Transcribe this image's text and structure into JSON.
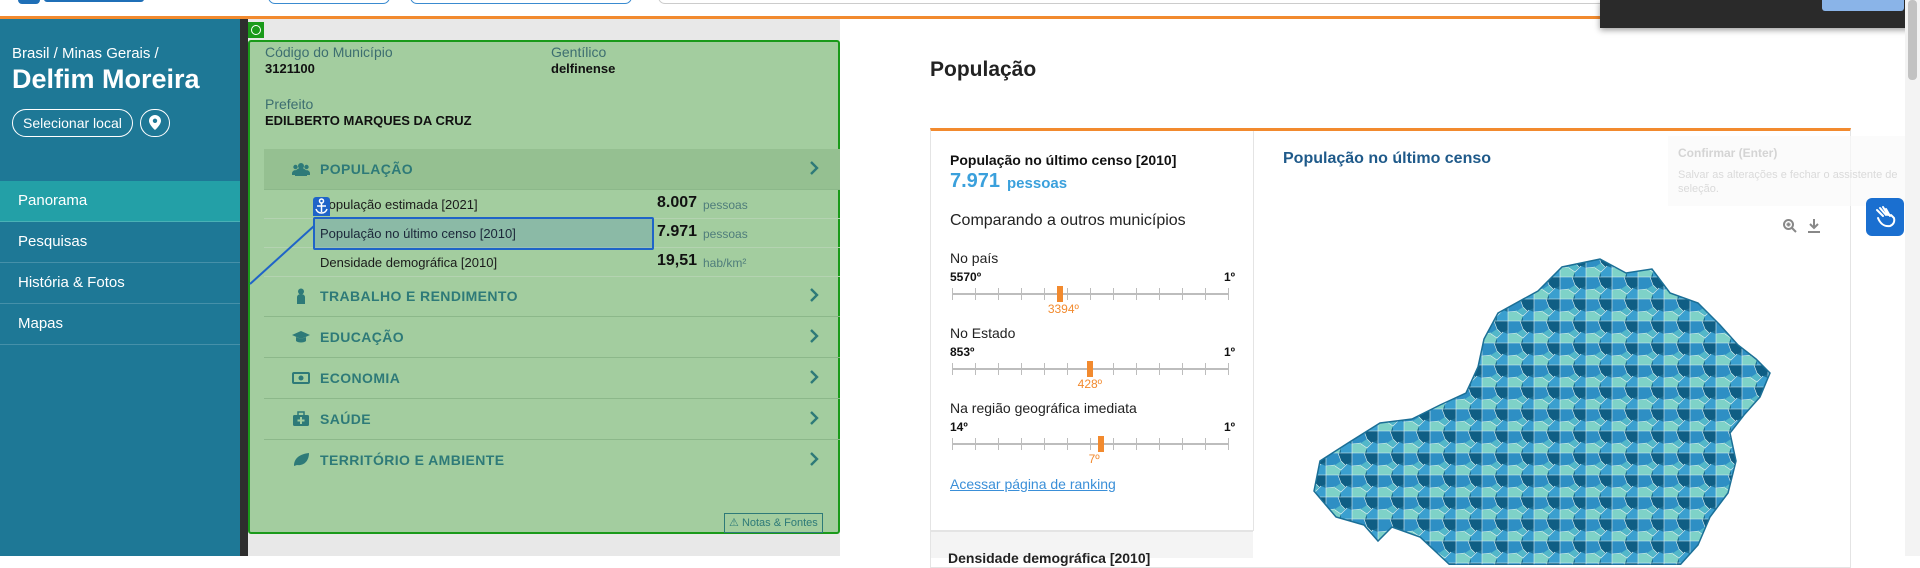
{
  "header": {},
  "breadcrumb": "Brasil / Minas Gerais /",
  "city": "Delfim Moreira",
  "select_place_label": "Selecionar local",
  "nav": [
    {
      "label": "Panorama",
      "active": true
    },
    {
      "label": "Pesquisas"
    },
    {
      "label": "História & Fotos"
    },
    {
      "label": "Mapas"
    }
  ],
  "info": {
    "codigo_label": "Código do Município",
    "codigo_value": "3121100",
    "gentilico_label": "Gentílico",
    "gentilico_value": "delfinense",
    "prefeito_label": "Prefeito",
    "prefeito_value": "EDILBERTO MARQUES DA CRUZ"
  },
  "sections": {
    "populacao": "POPULAÇÃO",
    "trabalho": "TRABALHO E RENDIMENTO",
    "educacao": "EDUCAÇÃO",
    "economia": "ECONOMIA",
    "saude": "SAÚDE",
    "territorio": "TERRITÓRIO E AMBIENTE"
  },
  "population_rows": [
    {
      "label": "População estimada [2021]",
      "value": "8.007",
      "unit": "pessoas"
    },
    {
      "label": "População no último censo [2010]",
      "value": "7.971",
      "unit": "pessoas"
    },
    {
      "label": "Densidade demográfica [2010]",
      "value": "19,51",
      "unit": "hab/km²"
    }
  ],
  "notes_label": "Notas & Fontes",
  "main": {
    "title": "População",
    "stat_title": "População no último censo [2010]",
    "stat_value": "7.971",
    "stat_unit": "pessoas",
    "compare_title": "Comparando a outros municípios",
    "rankings": [
      {
        "label": "No país",
        "low": "5570º",
        "high": "1º",
        "value": "3394º",
        "position": 0.3907
      },
      {
        "label": "No Estado",
        "low": "853º",
        "high": "1º",
        "value": "428º",
        "position": 0.4988
      },
      {
        "label": "Na região geográfica imediata",
        "low": "14º",
        "high": "1º",
        "value": "7º",
        "position": 0.5385
      }
    ],
    "ranking_link": "Acessar página de ranking",
    "next_stat_title": "Densidade demográfica [2010]",
    "map_title": "População no último censo"
  },
  "tooltip": {
    "title": "Confirmar (Enter)",
    "text": "Salvar as alterações e fechar o assistente de seleção."
  },
  "colors": {
    "sidebar": "#1e7896",
    "accent": "#f28a2e",
    "highlight_green": "#a3cd9f",
    "map_dark": "#1b6f96",
    "map_light": "#7ed2c8"
  }
}
